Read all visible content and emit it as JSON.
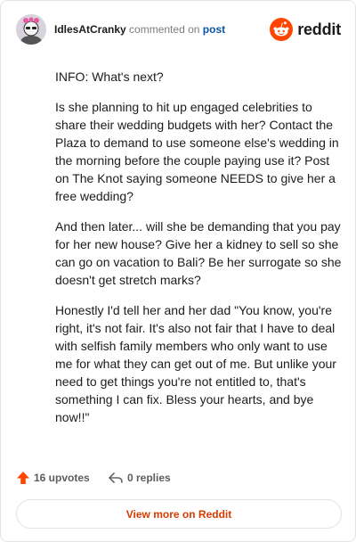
{
  "comment": {
    "username": "IdlesAtCranky",
    "action": "commented on",
    "post_link": "post",
    "paragraphs": [
      "INFO: What's next?",
      "Is she planning to hit up engaged celebrities to share their wedding budgets with her? Contact the Plaza to demand to use someone else's wedding in the morning before the couple paying use it? Post on The Knot saying someone NEEDS to give her a free wedding?",
      "And then later... will she be demanding that you pay for her new house? Give her a kidney to sell so she can go on vacation to Bali? Be her surrogate so she doesn't get stretch marks?",
      "Honestly I'd tell her and her dad \"You know, you're right, it's not fair. It's also not fair that I have to deal with selfish family members who only want to use me for what they can get out of me. But unlike your need to get things you're not entitled to, that's something I can fix. Bless your hearts, and bye now!!\""
    ]
  },
  "brand": {
    "wordmark": "reddit",
    "color": "#ff4500"
  },
  "footer": {
    "upvotes_label": "16 upvotes",
    "replies_label": "0 replies",
    "upvote_color": "#ff4500"
  },
  "view_more_label": "View more on Reddit",
  "icons": [
    "avatar",
    "reddit-snoo-icon",
    "upvote-arrow-icon",
    "reply-arrow-icon"
  ]
}
